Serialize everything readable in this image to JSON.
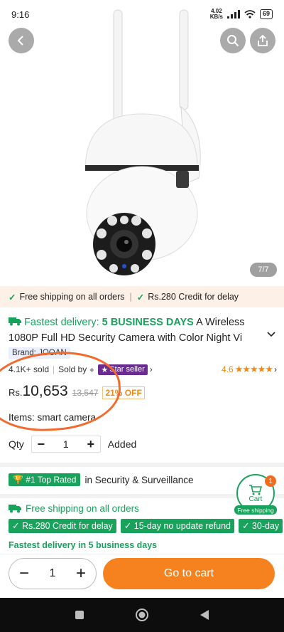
{
  "status": {
    "time": "9:16",
    "speed_top": "4.02",
    "speed_unit": "KB/s",
    "battery": "69"
  },
  "product": {
    "image_counter": "7/7",
    "ship_banner": {
      "left": "Free shipping on all orders",
      "right": "Rs.280 Credit for delay"
    },
    "title_prefix": "Fastest delivery: ",
    "title_days": "5 BUSINESS DAYS",
    "title_rest": " A Wireless 1080P Full HD Security Camera with Color Night Vi",
    "brand": "Brand: JOOAN",
    "sold": "4.1K+ sold",
    "sold_by": "Sold by",
    "seller_badge": "Star seller",
    "rating": "4.6",
    "price_currency": "Rs.",
    "price": "10,653",
    "old_price": "13,547",
    "discount": "21% OFF",
    "items": "Items: smart camera",
    "qty_label": "Qty",
    "qty_value": "1",
    "added": "Added",
    "top_rated_badge": "#1 Top Rated",
    "top_rated_text": "in Security & Surveillance",
    "free_shipping": "Free shipping on all orders",
    "chips": [
      "Rs.280 Credit for delay",
      "15-day no update refund",
      "30-day"
    ],
    "fastest_delivery": "Fastest delivery in 5 business days"
  },
  "cart": {
    "label": "Cart",
    "count": "1",
    "pill": "Free shipping"
  },
  "bottom": {
    "qty": "1",
    "go_to_cart": "Go to cart"
  },
  "colors": {
    "accent": "#f5821f",
    "green": "#18a25c",
    "purple": "#6a2c91"
  }
}
